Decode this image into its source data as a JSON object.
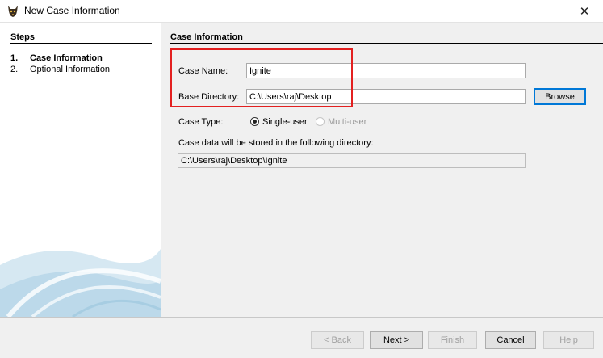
{
  "window": {
    "title": "New Case Information",
    "close_glyph": "✕"
  },
  "steps": {
    "heading": "Steps",
    "items": [
      {
        "number": "1.",
        "label": "Case Information",
        "active": true
      },
      {
        "number": "2.",
        "label": "Optional Information",
        "active": false
      }
    ]
  },
  "main": {
    "heading": "Case Information",
    "case_name": {
      "label": "Case Name:",
      "value": "Ignite"
    },
    "base_directory": {
      "label": "Base Directory:",
      "value": "C:\\Users\\raj\\Desktop",
      "browse_label": "Browse"
    },
    "case_type": {
      "label": "Case Type:",
      "options": [
        {
          "label": "Single-user",
          "selected": true,
          "enabled": true
        },
        {
          "label": "Multi-user",
          "selected": false,
          "enabled": false
        }
      ]
    },
    "storage_note": "Case data will be stored in the following directory:",
    "storage_path": "C:\\Users\\raj\\Desktop\\Ignite"
  },
  "buttons": {
    "back": "< Back",
    "next": "Next >",
    "finish": "Finish",
    "cancel": "Cancel",
    "help": "Help"
  },
  "colors": {
    "highlight": "#e32020",
    "focus_border": "#0078d7"
  },
  "icons": [
    "app-icon",
    "close-icon"
  ]
}
